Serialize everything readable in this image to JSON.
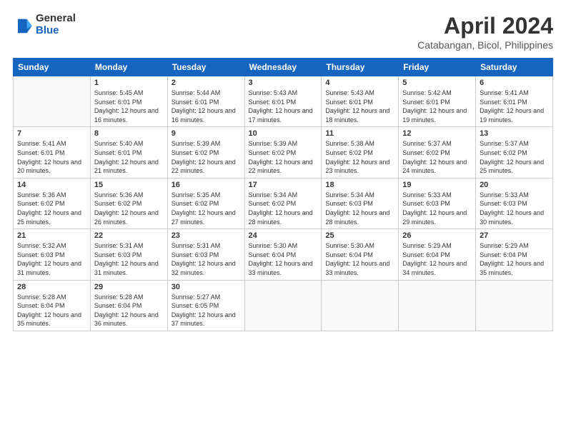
{
  "header": {
    "logo_general": "General",
    "logo_blue": "Blue",
    "month_title": "April 2024",
    "location": "Catabangan, Bicol, Philippines"
  },
  "weekdays": [
    "Sunday",
    "Monday",
    "Tuesday",
    "Wednesday",
    "Thursday",
    "Friday",
    "Saturday"
  ],
  "weeks": [
    [
      {
        "day": "",
        "info": ""
      },
      {
        "day": "1",
        "info": "Sunrise: 5:45 AM\nSunset: 6:01 PM\nDaylight: 12 hours\nand 16 minutes."
      },
      {
        "day": "2",
        "info": "Sunrise: 5:44 AM\nSunset: 6:01 PM\nDaylight: 12 hours\nand 16 minutes."
      },
      {
        "day": "3",
        "info": "Sunrise: 5:43 AM\nSunset: 6:01 PM\nDaylight: 12 hours\nand 17 minutes."
      },
      {
        "day": "4",
        "info": "Sunrise: 5:43 AM\nSunset: 6:01 PM\nDaylight: 12 hours\nand 18 minutes."
      },
      {
        "day": "5",
        "info": "Sunrise: 5:42 AM\nSunset: 6:01 PM\nDaylight: 12 hours\nand 19 minutes."
      },
      {
        "day": "6",
        "info": "Sunrise: 5:41 AM\nSunset: 6:01 PM\nDaylight: 12 hours\nand 19 minutes."
      }
    ],
    [
      {
        "day": "7",
        "info": "Sunrise: 5:41 AM\nSunset: 6:01 PM\nDaylight: 12 hours\nand 20 minutes."
      },
      {
        "day": "8",
        "info": "Sunrise: 5:40 AM\nSunset: 6:01 PM\nDaylight: 12 hours\nand 21 minutes."
      },
      {
        "day": "9",
        "info": "Sunrise: 5:39 AM\nSunset: 6:02 PM\nDaylight: 12 hours\nand 22 minutes."
      },
      {
        "day": "10",
        "info": "Sunrise: 5:39 AM\nSunset: 6:02 PM\nDaylight: 12 hours\nand 22 minutes."
      },
      {
        "day": "11",
        "info": "Sunrise: 5:38 AM\nSunset: 6:02 PM\nDaylight: 12 hours\nand 23 minutes."
      },
      {
        "day": "12",
        "info": "Sunrise: 5:37 AM\nSunset: 6:02 PM\nDaylight: 12 hours\nand 24 minutes."
      },
      {
        "day": "13",
        "info": "Sunrise: 5:37 AM\nSunset: 6:02 PM\nDaylight: 12 hours\nand 25 minutes."
      }
    ],
    [
      {
        "day": "14",
        "info": "Sunrise: 5:36 AM\nSunset: 6:02 PM\nDaylight: 12 hours\nand 25 minutes."
      },
      {
        "day": "15",
        "info": "Sunrise: 5:36 AM\nSunset: 6:02 PM\nDaylight: 12 hours\nand 26 minutes."
      },
      {
        "day": "16",
        "info": "Sunrise: 5:35 AM\nSunset: 6:02 PM\nDaylight: 12 hours\nand 27 minutes."
      },
      {
        "day": "17",
        "info": "Sunrise: 5:34 AM\nSunset: 6:02 PM\nDaylight: 12 hours\nand 28 minutes."
      },
      {
        "day": "18",
        "info": "Sunrise: 5:34 AM\nSunset: 6:03 PM\nDaylight: 12 hours\nand 28 minutes."
      },
      {
        "day": "19",
        "info": "Sunrise: 5:33 AM\nSunset: 6:03 PM\nDaylight: 12 hours\nand 29 minutes."
      },
      {
        "day": "20",
        "info": "Sunrise: 5:33 AM\nSunset: 6:03 PM\nDaylight: 12 hours\nand 30 minutes."
      }
    ],
    [
      {
        "day": "21",
        "info": "Sunrise: 5:32 AM\nSunset: 6:03 PM\nDaylight: 12 hours\nand 31 minutes."
      },
      {
        "day": "22",
        "info": "Sunrise: 5:31 AM\nSunset: 6:03 PM\nDaylight: 12 hours\nand 31 minutes."
      },
      {
        "day": "23",
        "info": "Sunrise: 5:31 AM\nSunset: 6:03 PM\nDaylight: 12 hours\nand 32 minutes."
      },
      {
        "day": "24",
        "info": "Sunrise: 5:30 AM\nSunset: 6:04 PM\nDaylight: 12 hours\nand 33 minutes."
      },
      {
        "day": "25",
        "info": "Sunrise: 5:30 AM\nSunset: 6:04 PM\nDaylight: 12 hours\nand 33 minutes."
      },
      {
        "day": "26",
        "info": "Sunrise: 5:29 AM\nSunset: 6:04 PM\nDaylight: 12 hours\nand 34 minutes."
      },
      {
        "day": "27",
        "info": "Sunrise: 5:29 AM\nSunset: 6:04 PM\nDaylight: 12 hours\nand 35 minutes."
      }
    ],
    [
      {
        "day": "28",
        "info": "Sunrise: 5:28 AM\nSunset: 6:04 PM\nDaylight: 12 hours\nand 35 minutes."
      },
      {
        "day": "29",
        "info": "Sunrise: 5:28 AM\nSunset: 6:04 PM\nDaylight: 12 hours\nand 36 minutes."
      },
      {
        "day": "30",
        "info": "Sunrise: 5:27 AM\nSunset: 6:05 PM\nDaylight: 12 hours\nand 37 minutes."
      },
      {
        "day": "",
        "info": ""
      },
      {
        "day": "",
        "info": ""
      },
      {
        "day": "",
        "info": ""
      },
      {
        "day": "",
        "info": ""
      }
    ]
  ]
}
